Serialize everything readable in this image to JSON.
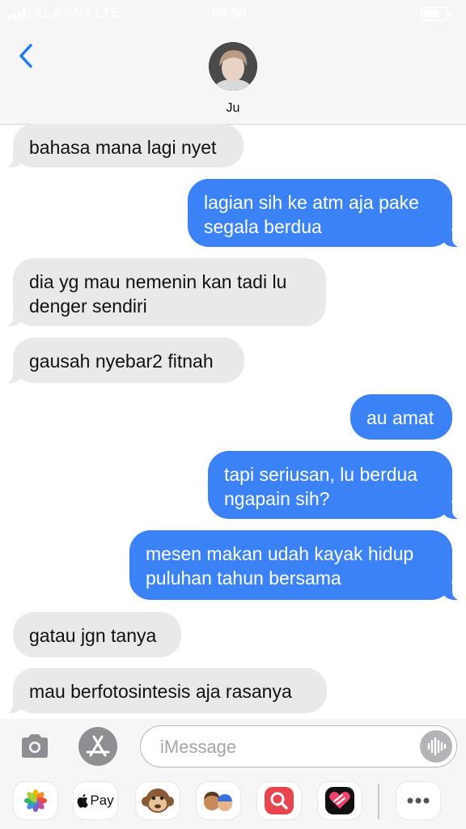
{
  "status_bar": {
    "carrier": "XL Axiata  LTE",
    "time": "06.50",
    "battery_level": 0.8
  },
  "header": {
    "contact_name": "Ju"
  },
  "messages": [
    {
      "from": "contact",
      "text": "bahasa mana lagi nyet"
    },
    {
      "from": "me",
      "text": "lagian sih ke atm aja pake\nsegala berdua"
    },
    {
      "from": "contact",
      "text": "dia yg mau nemenin kan tadi lu\ndenger sendiri"
    },
    {
      "from": "contact",
      "text": "gausah nyebar2 fitnah"
    },
    {
      "from": "me",
      "text": "au amat"
    },
    {
      "from": "me",
      "text": "tapi seriusan, lu berdua\nngapain sih?"
    },
    {
      "from": "me",
      "text": "mesen makan udah kayak hidup\npuluhan tahun bersama"
    },
    {
      "from": "contact",
      "text": "gatau jgn tanya"
    },
    {
      "from": "contact",
      "text": "mau berfotosintesis aja rasanya"
    }
  ],
  "composer": {
    "placeholder": "iMessage"
  },
  "app_drawer": {
    "apple_pay_label": "Pay",
    "icons": [
      "photos-icon",
      "apple-pay-icon",
      "monkey-animoji-icon",
      "memoji-icon",
      "image-search-icon",
      "digital-touch-icon",
      "more-icon"
    ]
  },
  "colors": {
    "sent_bubble": "#3b82f6",
    "received_bubble": "#e9e9eb",
    "accent": "#1e7cf2"
  }
}
